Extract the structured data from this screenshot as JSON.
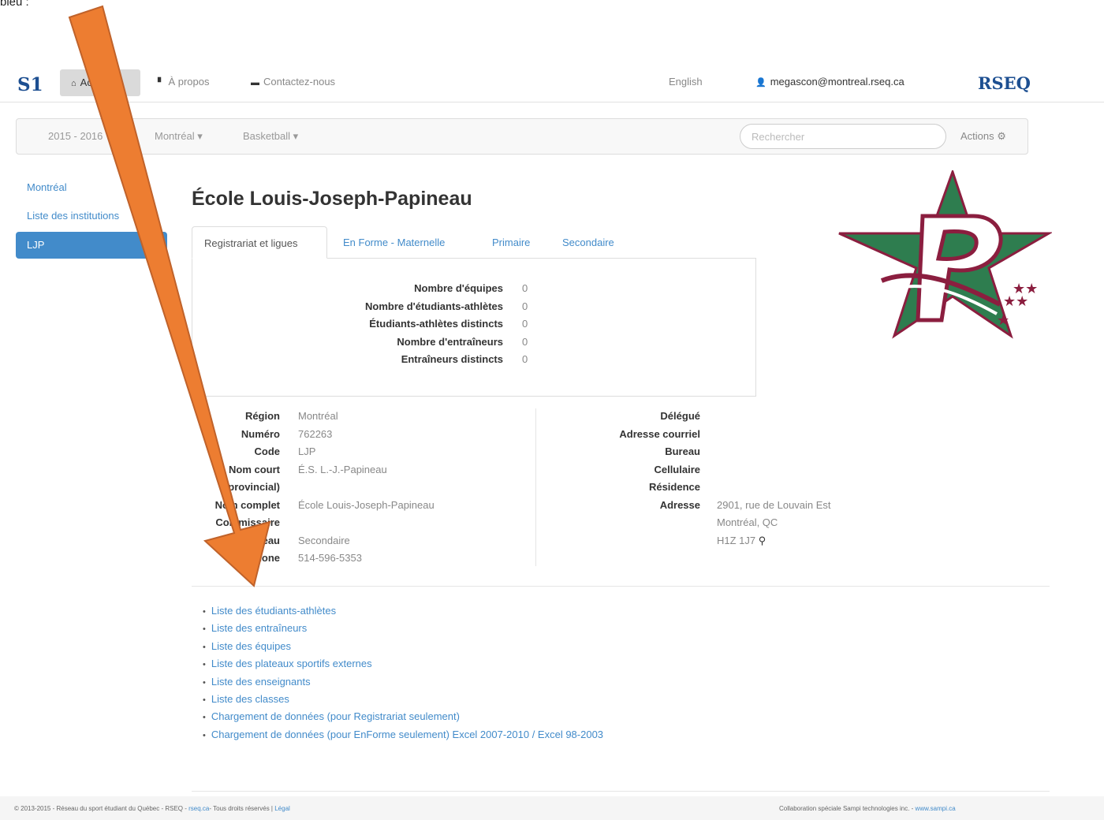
{
  "caption": "bleu :",
  "navbar": {
    "brand": "S1",
    "home": "Accueil",
    "about": "À propos",
    "contact": "Contactez-nous",
    "language": "English",
    "user": "megascon@montreal.rseq.ca",
    "org": "RSEQ"
  },
  "subbar": {
    "season": "2015 - 2016",
    "region": "Montréal ▾",
    "sport": "Basketball ▾",
    "search_placeholder": "Rechercher",
    "actions": "Actions"
  },
  "sidebar": {
    "items": [
      {
        "label": "Montréal"
      },
      {
        "label": "Liste des institutions"
      },
      {
        "label": "LJP"
      }
    ]
  },
  "school": {
    "title": "École Louis-Joseph-Papineau"
  },
  "tabs": [
    {
      "label": "Registrariat et ligues"
    },
    {
      "label": "En Forme - Maternelle"
    },
    {
      "label": "Primaire"
    },
    {
      "label": "Secondaire"
    }
  ],
  "stats": [
    {
      "label": "Nombre d'équipes",
      "value": "0"
    },
    {
      "label": "Nombre d'étudiants-athlètes",
      "value": "0"
    },
    {
      "label": "Étudiants-athlètes distincts",
      "value": "0"
    },
    {
      "label": "Nombre d'entraîneurs",
      "value": "0"
    },
    {
      "label": "Entraîneurs distincts",
      "value": "0"
    }
  ],
  "info_left": [
    {
      "label": "Région",
      "value": "Montréal"
    },
    {
      "label": "Numéro",
      "value": "762263"
    },
    {
      "label": "Code",
      "value": "LJP"
    },
    {
      "label": "Nom court",
      "value": "É.S. L.-J.-Papineau"
    },
    {
      "label": "(provincial)",
      "value": ""
    },
    {
      "label": "Nom complet",
      "value": "École Louis-Joseph-Papineau"
    },
    {
      "label": "Commissaire",
      "value": ""
    },
    {
      "label": "Niveau",
      "value": "Secondaire"
    },
    {
      "label": "Téléphone",
      "value": "514-596-5353"
    }
  ],
  "info_right": [
    {
      "label": "Délégué",
      "value": ""
    },
    {
      "label": "Adresse courriel",
      "value": ""
    },
    {
      "label": "Bureau",
      "value": ""
    },
    {
      "label": "Cellulaire",
      "value": ""
    },
    {
      "label": "Résidence",
      "value": ""
    },
    {
      "label": "Adresse",
      "value": "2901, rue de Louvain Est"
    },
    {
      "label": "",
      "value": "Montréal, QC"
    },
    {
      "label": "",
      "value": "H1Z 1J7"
    }
  ],
  "links": [
    "Liste des étudiants-athlètes",
    "Liste des entraîneurs",
    "Liste des équipes",
    "Liste des plateaux sportifs externes",
    "Liste des enseignants",
    "Liste des classes",
    "Chargement de données (pour Registrariat seulement)",
    "Chargement de données (pour EnForme seulement)  Excel 2007-2010 / Excel 98-2003"
  ],
  "footer": {
    "left_text": "© 2013-2015 - Réseau du sport étudiant du Québec - RSEQ - ",
    "left_link": "rseq.ca",
    "left_rest": "- Tous droits réservés | ",
    "left_legal": "Légal",
    "right_text": "Collaboration spéciale Sampi technologies inc. - ",
    "right_link": "www.sampi.ca"
  },
  "colors": {
    "link": "#428bca",
    "brand": "#1d4f91",
    "arrow": "#ed7d31",
    "logo_green": "#2e7d4f",
    "logo_maroon": "#8b1e3f"
  }
}
